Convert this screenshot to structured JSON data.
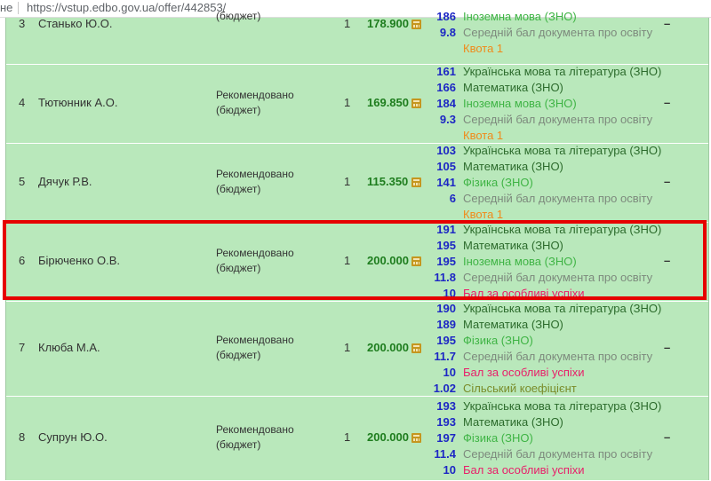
{
  "address_bar": {
    "security": "не",
    "url": "https://vstup.edbo.gov.ua/offer/442853/"
  },
  "rows": [
    {
      "num": "3",
      "name": "Станько Ю.О.",
      "status_l1": "",
      "status_l2": "(бюджет)",
      "prio": "1",
      "score": "178.900",
      "components": [
        {
          "v": "186",
          "n": "Іноземна мова (ЗНО)"
        },
        {
          "v": "9.8",
          "n": "Середній бал документа про освіту"
        },
        {
          "v": "",
          "n": "Квота 1"
        }
      ]
    },
    {
      "num": "4",
      "name": "Тютюнник А.О.",
      "status_l1": "Рекомендовано",
      "status_l2": "(бюджет)",
      "prio": "1",
      "score": "169.850",
      "components": [
        {
          "v": "161",
          "n": "Українська мова та література (ЗНО)"
        },
        {
          "v": "166",
          "n": "Математика (ЗНО)"
        },
        {
          "v": "184",
          "n": "Іноземна мова (ЗНО)"
        },
        {
          "v": "9.3",
          "n": "Середній бал документа про освіту"
        },
        {
          "v": "",
          "n": "Квота 1"
        }
      ]
    },
    {
      "num": "5",
      "name": "Дячук Р.В.",
      "status_l1": "Рекомендовано",
      "status_l2": "(бюджет)",
      "prio": "1",
      "score": "115.350",
      "components": [
        {
          "v": "103",
          "n": "Українська мова та література (ЗНО)"
        },
        {
          "v": "105",
          "n": "Математика (ЗНО)"
        },
        {
          "v": "141",
          "n": "Фізика (ЗНО)"
        },
        {
          "v": "6",
          "n": "Середній бал документа про освіту"
        },
        {
          "v": "",
          "n": "Квота 1"
        }
      ]
    },
    {
      "num": "6",
      "name": "Бірюченко О.В.",
      "status_l1": "Рекомендовано",
      "status_l2": "(бюджет)",
      "prio": "1",
      "score": "200.000",
      "components": [
        {
          "v": "191",
          "n": "Українська мова та література (ЗНО)"
        },
        {
          "v": "195",
          "n": "Математика (ЗНО)"
        },
        {
          "v": "195",
          "n": "Іноземна мова (ЗНО)"
        },
        {
          "v": "11.8",
          "n": "Середній бал документа про освіту"
        },
        {
          "v": "10",
          "n": "Бал за особливі успіхи"
        }
      ]
    },
    {
      "num": "7",
      "name": "Клюба М.А.",
      "status_l1": "Рекомендовано",
      "status_l2": "(бюджет)",
      "prio": "1",
      "score": "200.000",
      "components": [
        {
          "v": "190",
          "n": "Українська мова та література (ЗНО)"
        },
        {
          "v": "189",
          "n": "Математика (ЗНО)"
        },
        {
          "v": "195",
          "n": "Фізика (ЗНО)"
        },
        {
          "v": "11.7",
          "n": "Середній бал документа про освіту"
        },
        {
          "v": "10",
          "n": "Бал за особливі успіхи"
        },
        {
          "v": "1.02",
          "n": "Сільський коефіцієнт"
        }
      ]
    },
    {
      "num": "8",
      "name": "Супрун Ю.О.",
      "status_l1": "Рекомендовано",
      "status_l2": "(бюджет)",
      "prio": "1",
      "score": "200.000",
      "components": [
        {
          "v": "193",
          "n": "Українська мова та література (ЗНО)"
        },
        {
          "v": "193",
          "n": "Математика (ЗНО)"
        },
        {
          "v": "197",
          "n": "Фізика (ЗНО)"
        },
        {
          "v": "11.4",
          "n": "Середній бал документа про освіту"
        },
        {
          "v": "10",
          "n": "Бал за особливі успіхи"
        }
      ]
    }
  ],
  "dash": "–",
  "component_colors": {
    "ukr": "#2c6b2c",
    "mat": "#2c6b2c",
    "for": "#3fb445",
    "phy": "#3fb445",
    "avg": "#7d8a7d",
    "kv": "#f08a1a",
    "suc": "#e8206a",
    "sil": "#7a8c2a"
  },
  "highlight_color": "#e60000"
}
